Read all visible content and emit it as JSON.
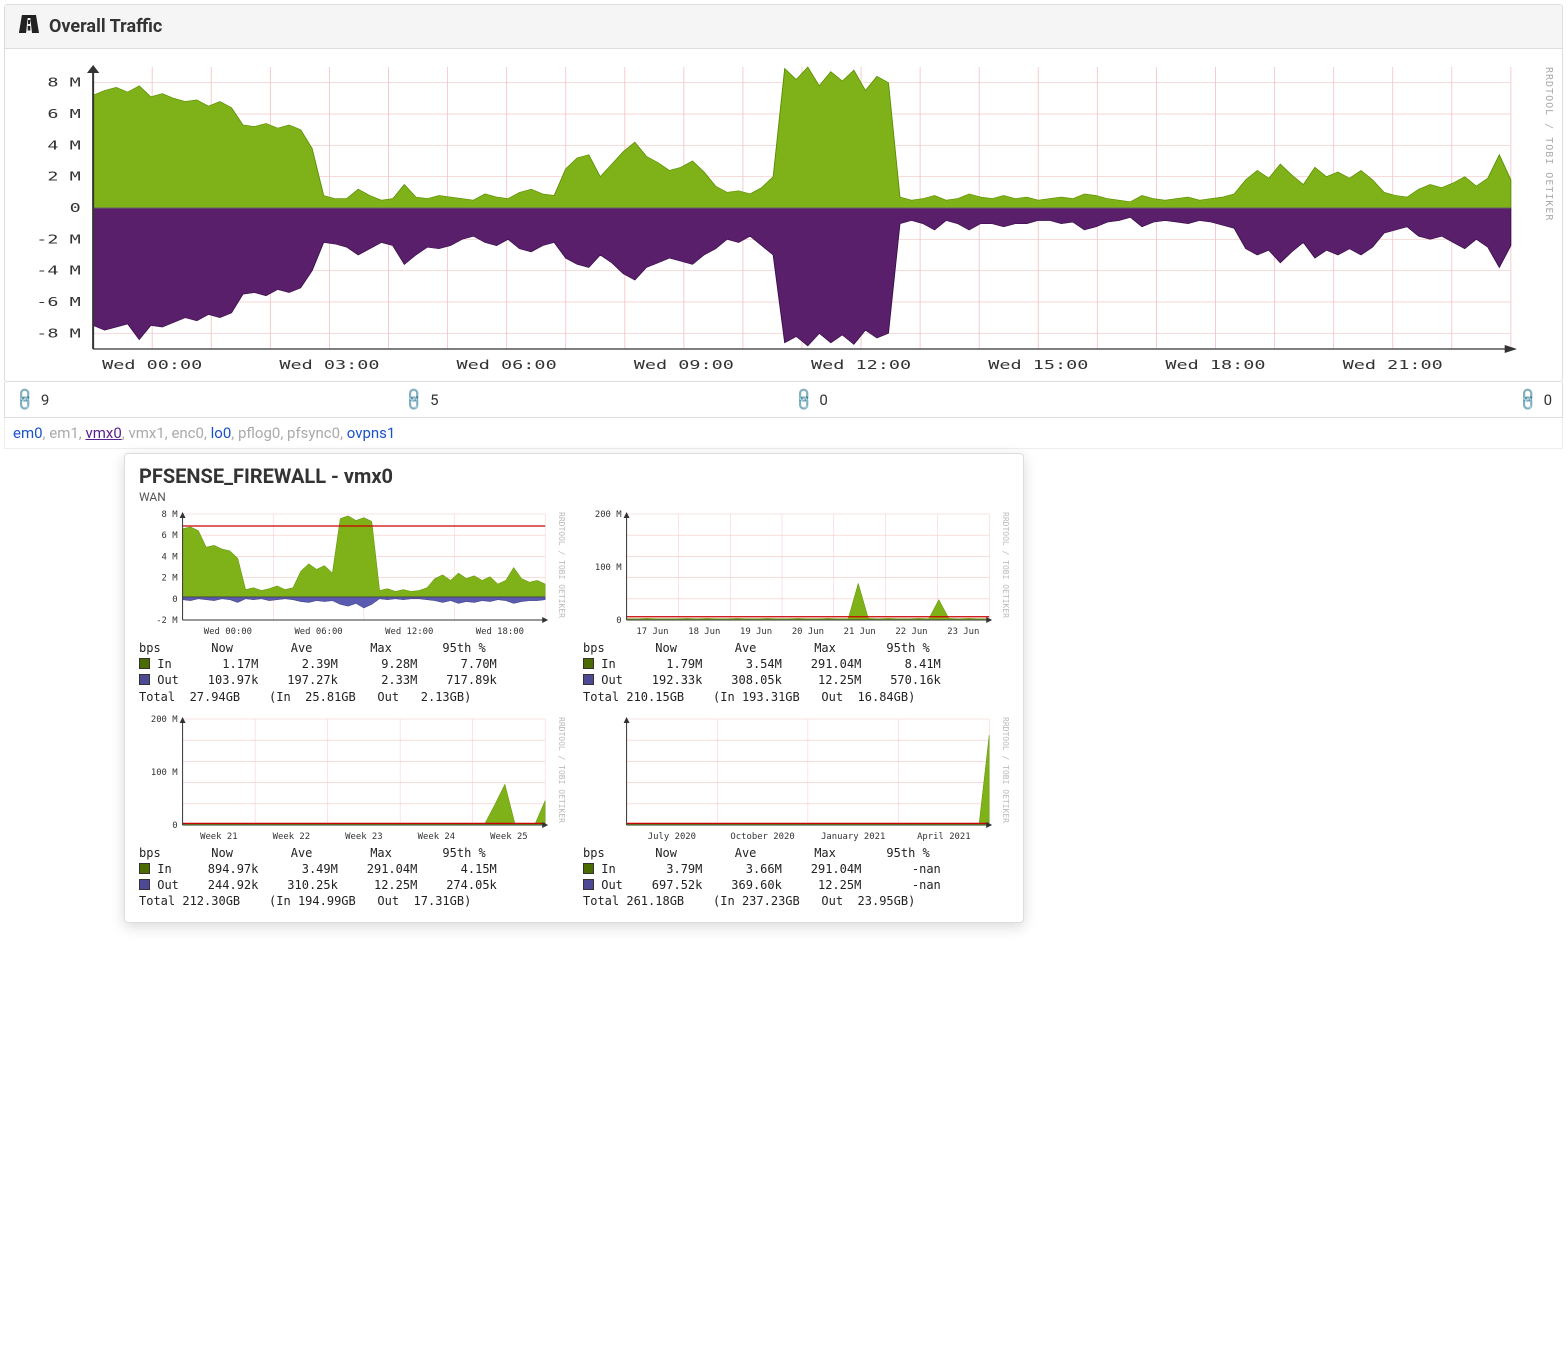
{
  "header": {
    "title": "Overall Traffic"
  },
  "side_label": "RRDTOOL / TOBI OETIKER",
  "big_chart": {
    "ylim": [
      -9,
      9
    ],
    "y_ticks": [
      "8 M",
      "6 M",
      "4 M",
      "2 M",
      "0",
      "-2 M",
      "-4 M",
      "-6 M",
      "-8 M"
    ],
    "x_ticks": [
      "Wed 00:00",
      "Wed 03:00",
      "Wed 06:00",
      "Wed 09:00",
      "Wed 12:00",
      "Wed 15:00",
      "Wed 18:00",
      "Wed 21:00"
    ],
    "series_in": [
      7.2,
      7.5,
      7.7,
      7.4,
      7.8,
      7.1,
      7.3,
      7.0,
      6.8,
      6.9,
      6.5,
      6.8,
      6.4,
      5.3,
      5.2,
      5.4,
      5.1,
      5.3,
      5.0,
      3.8,
      0.8,
      0.6,
      0.6,
      1.2,
      0.8,
      0.5,
      0.6,
      1.5,
      0.7,
      0.6,
      0.8,
      0.7,
      0.6,
      0.5,
      0.9,
      0.7,
      0.6,
      1.0,
      1.2,
      0.9,
      0.8,
      2.5,
      3.2,
      3.4,
      2.0,
      2.8,
      3.6,
      4.2,
      3.3,
      2.9,
      2.4,
      2.6,
      3.0,
      2.3,
      1.4,
      1.0,
      1.1,
      0.9,
      1.3,
      2.0,
      8.9,
      8.2,
      9.0,
      7.8,
      8.7,
      8.1,
      8.8,
      7.5,
      8.4,
      8.0,
      0.7,
      0.5,
      0.6,
      0.8,
      0.5,
      0.6,
      0.9,
      0.7,
      0.6,
      0.8,
      0.6,
      0.7,
      0.5,
      0.6,
      0.7,
      0.6,
      0.9,
      0.8,
      0.6,
      0.5,
      0.4,
      0.8,
      0.6,
      0.5,
      0.6,
      0.7,
      0.5,
      0.6,
      0.7,
      0.9,
      1.8,
      2.4,
      1.9,
      2.8,
      2.1,
      1.5,
      2.6,
      2.0,
      2.3,
      1.9,
      2.4,
      1.8,
      1.0,
      0.8,
      0.7,
      1.2,
      1.5,
      1.3,
      1.6,
      2.0,
      1.4,
      1.9,
      3.4,
      1.8
    ],
    "series_out": [
      -7.5,
      -7.8,
      -7.6,
      -7.4,
      -8.4,
      -7.5,
      -7.6,
      -7.3,
      -7.0,
      -7.2,
      -6.8,
      -7.0,
      -6.7,
      -5.5,
      -5.4,
      -5.6,
      -5.2,
      -5.4,
      -5.1,
      -4.0,
      -2.2,
      -2.3,
      -2.5,
      -3.0,
      -2.6,
      -2.2,
      -2.4,
      -3.6,
      -3.0,
      -2.5,
      -2.6,
      -2.4,
      -2.0,
      -1.8,
      -2.2,
      -2.4,
      -2.0,
      -2.6,
      -2.8,
      -2.4,
      -2.2,
      -3.2,
      -3.6,
      -3.8,
      -3.0,
      -3.5,
      -4.2,
      -4.6,
      -3.8,
      -3.5,
      -3.2,
      -3.4,
      -3.6,
      -3.0,
      -2.6,
      -2.0,
      -2.2,
      -1.8,
      -2.4,
      -3.0,
      -8.6,
      -8.2,
      -8.8,
      -8.0,
      -8.6,
      -8.1,
      -8.7,
      -7.8,
      -8.3,
      -8.0,
      -1.0,
      -0.8,
      -1.0,
      -1.4,
      -0.8,
      -1.0,
      -1.4,
      -1.0,
      -1.0,
      -1.2,
      -1.0,
      -1.0,
      -0.8,
      -0.8,
      -1.0,
      -0.9,
      -1.4,
      -1.2,
      -0.9,
      -0.8,
      -0.6,
      -1.2,
      -0.9,
      -0.8,
      -0.9,
      -1.0,
      -0.8,
      -0.9,
      -1.1,
      -1.3,
      -2.6,
      -3.0,
      -2.7,
      -3.5,
      -2.8,
      -2.2,
      -3.2,
      -2.7,
      -3.0,
      -2.6,
      -3.0,
      -2.5,
      -1.6,
      -1.4,
      -1.2,
      -1.8,
      -2.0,
      -1.8,
      -2.2,
      -2.6,
      -2.0,
      -2.5,
      -3.8,
      -2.4
    ]
  },
  "status": {
    "total": "9",
    "up": "5",
    "down": "0",
    "unknown": "0"
  },
  "interfaces": [
    {
      "name": "em0",
      "cls": "if-blue"
    },
    {
      "name": "em1",
      "cls": "if-gray"
    },
    {
      "name": "vmx0",
      "cls": "if-purple underline"
    },
    {
      "name": "vmx1",
      "cls": "if-gray"
    },
    {
      "name": "enc0",
      "cls": "if-gray"
    },
    {
      "name": "lo0",
      "cls": "if-blue"
    },
    {
      "name": "pflog0",
      "cls": "if-gray"
    },
    {
      "name": "pfsync0",
      "cls": "if-gray"
    },
    {
      "name": "ovpns1",
      "cls": "if-blue"
    }
  ],
  "popup": {
    "title": "PFSENSE_FIREWALL - vmx0",
    "subtitle": "WAN",
    "charts": [
      {
        "y_ticks": [
          "8 M",
          "6 M",
          "4 M",
          "2 M",
          "0",
          "-2 M"
        ],
        "ylim": [
          -2.5,
          9
        ],
        "x_ticks": [
          "Wed 00:00",
          "Wed 06:00",
          "Wed 12:00",
          "Wed 18:00"
        ],
        "redline": 7.7,
        "series_in": [
          7.4,
          7.6,
          7.2,
          5.4,
          5.6,
          5.2,
          5.0,
          4.2,
          0.8,
          1.0,
          0.7,
          0.9,
          1.2,
          0.8,
          1.0,
          2.8,
          3.6,
          3.0,
          3.4,
          2.6,
          8.5,
          8.8,
          8.3,
          8.6,
          8.2,
          0.7,
          0.9,
          0.6,
          0.8,
          0.6,
          0.7,
          1.0,
          2.0,
          2.4,
          1.8,
          2.6,
          2.0,
          2.3,
          1.8,
          2.2,
          1.4,
          1.8,
          3.2,
          2.0,
          1.6,
          1.8,
          1.4
        ],
        "series_out": [
          -0.3,
          -0.4,
          -0.2,
          -0.3,
          -0.4,
          -0.2,
          -0.3,
          -0.6,
          -0.2,
          -0.3,
          -0.2,
          -0.4,
          -0.3,
          -0.2,
          -0.3,
          -0.5,
          -0.6,
          -0.4,
          -0.5,
          -0.4,
          -0.8,
          -1.0,
          -0.7,
          -1.2,
          -0.8,
          -0.2,
          -0.3,
          -0.2,
          -0.3,
          -0.2,
          -0.2,
          -0.3,
          -0.4,
          -0.6,
          -0.4,
          -0.7,
          -0.5,
          -0.6,
          -0.4,
          -0.5,
          -0.3,
          -0.4,
          -0.7,
          -0.5,
          -0.4,
          -0.4,
          -0.3
        ],
        "stats": {
          "header": "bps       Now        Ave        Max       95th %",
          "in": "In       1.17M      2.39M      9.28M      7.70M",
          "out": "Out    103.97k    197.27k      2.33M    717.89k",
          "total": "Total  27.94GB    (In  25.81GB   Out   2.13GB)"
        }
      },
      {
        "y_ticks": [
          "200 M",
          "100 M",
          "0"
        ],
        "ylim": [
          0,
          260
        ],
        "x_ticks": [
          "17 Jun",
          "18 Jun",
          "19 Jun",
          "20 Jun",
          "21 Jun",
          "22 Jun",
          "23 Jun"
        ],
        "redline": 8,
        "series_in": [
          3,
          3,
          4,
          3,
          3,
          3,
          4,
          3,
          4,
          3,
          3,
          4,
          3,
          3,
          4,
          3,
          3,
          4,
          3,
          3,
          4,
          3,
          3,
          90,
          4,
          3,
          4,
          3,
          3,
          4,
          3,
          50,
          4,
          3,
          4,
          3,
          3
        ],
        "series_out": [
          0,
          0,
          0,
          0,
          0,
          0,
          0,
          0,
          0,
          0,
          0,
          0,
          0,
          0,
          0,
          0,
          0,
          0,
          0,
          0,
          0,
          0,
          0,
          0,
          0,
          0,
          0,
          0,
          0,
          0,
          0,
          0,
          0,
          0,
          0,
          0,
          0
        ],
        "stats": {
          "header": "bps       Now        Ave        Max       95th %",
          "in": "In       1.79M      3.54M    291.04M      8.41M",
          "out": "Out    192.33k    308.05k     12.25M    570.16k",
          "total": "Total 210.15GB    (In 193.31GB   Out  16.84GB)"
        }
      },
      {
        "y_ticks": [
          "200 M",
          "100 M",
          "0"
        ],
        "ylim": [
          0,
          260
        ],
        "x_ticks": [
          "Week 21",
          "Week 22",
          "Week 23",
          "Week 24",
          "Week 25"
        ],
        "redline": 4,
        "series_in": [
          3,
          3,
          4,
          3,
          3,
          3,
          4,
          3,
          4,
          3,
          3,
          4,
          3,
          3,
          4,
          3,
          3,
          4,
          3,
          3,
          4,
          3,
          3,
          4,
          4,
          3,
          4,
          3,
          3,
          4,
          3,
          50,
          100,
          3,
          4,
          3,
          60
        ],
        "series_out": [
          0,
          0,
          0,
          0,
          0,
          0,
          0,
          0,
          0,
          0,
          0,
          0,
          0,
          0,
          0,
          0,
          0,
          0,
          0,
          0,
          0,
          0,
          0,
          0,
          0,
          0,
          0,
          0,
          0,
          0,
          0,
          0,
          0,
          0,
          0,
          0,
          0
        ],
        "stats": {
          "header": "bps       Now        Ave        Max       95th %",
          "in": "In     894.97k      3.49M    291.04M      4.15M",
          "out": "Out    244.92k    310.25k     12.25M    274.05k",
          "total": "Total 212.30GB    (In 194.99GB   Out  17.31GB)"
        }
      },
      {
        "y_ticks": [
          "",
          "",
          ""
        ],
        "ylim": [
          0,
          260
        ],
        "x_ticks": [
          "July 2020",
          "October 2020",
          "January 2021",
          "April 2021"
        ],
        "redline": 4,
        "series_in": [
          3,
          3,
          4,
          3,
          3,
          3,
          4,
          3,
          4,
          3,
          3,
          4,
          3,
          3,
          4,
          3,
          3,
          4,
          3,
          3,
          4,
          3,
          3,
          4,
          4,
          3,
          4,
          3,
          3,
          4,
          3,
          3,
          4,
          3,
          4,
          3,
          220
        ],
        "series_out": [
          0,
          0,
          0,
          0,
          0,
          0,
          0,
          0,
          0,
          0,
          0,
          0,
          0,
          0,
          0,
          0,
          0,
          0,
          0,
          0,
          0,
          0,
          0,
          0,
          0,
          0,
          0,
          0,
          0,
          0,
          0,
          0,
          0,
          0,
          0,
          0,
          0
        ],
        "stats": {
          "header": "bps       Now        Ave        Max       95th %",
          "in": "In       3.79M      3.66M    291.04M       -nan",
          "out": "Out    697.52k    369.60k     12.25M       -nan",
          "total": "Total 261.18GB    (In 237.23GB   Out  23.95GB)"
        }
      }
    ]
  },
  "chart_data": {
    "type": "area",
    "title": "Overall Traffic",
    "xlabel": "",
    "ylabel": "bps",
    "ylim": [
      -9000000,
      9000000
    ],
    "x_ticks": [
      "Wed 00:00",
      "Wed 03:00",
      "Wed 06:00",
      "Wed 09:00",
      "Wed 12:00",
      "Wed 15:00",
      "Wed 18:00",
      "Wed 21:00"
    ],
    "series": [
      {
        "name": "In (positive)",
        "color": "#7fb219",
        "values": [
          7.2,
          7.5,
          7.7,
          7.4,
          7.8,
          7.1,
          7.3,
          7.0,
          6.8,
          6.9,
          6.5,
          6.8,
          6.4,
          5.3,
          5.2,
          5.4,
          5.1,
          5.3,
          5.0,
          3.8,
          0.8,
          0.6,
          0.6,
          1.2,
          0.8,
          0.5,
          0.6,
          1.5,
          0.7,
          0.6,
          0.8,
          0.7,
          0.6,
          0.5,
          0.9,
          0.7,
          0.6,
          1.0,
          1.2,
          0.9,
          0.8,
          2.5,
          3.2,
          3.4,
          2.0,
          2.8,
          3.6,
          4.2,
          3.3,
          2.9,
          2.4,
          2.6,
          3.0,
          2.3,
          1.4,
          1.0,
          1.1,
          0.9,
          1.3,
          2.0,
          8.9,
          8.2,
          9.0,
          7.8,
          8.7,
          8.1,
          8.8,
          7.5,
          8.4,
          8.0,
          0.7,
          0.5,
          0.6,
          0.8,
          0.5,
          0.6,
          0.9,
          0.7,
          0.6,
          0.8,
          0.6,
          0.7,
          0.5,
          0.6,
          0.7,
          0.6,
          0.9,
          0.8,
          0.6,
          0.5,
          0.4,
          0.8,
          0.6,
          0.5,
          0.6,
          0.7,
          0.5,
          0.6,
          0.7,
          0.9,
          1.8,
          2.4,
          1.9,
          2.8,
          2.1,
          1.5,
          2.6,
          2.0,
          2.3,
          1.9,
          2.4,
          1.8,
          1.0,
          0.8,
          0.7,
          1.2,
          1.5,
          1.3,
          1.6,
          2.0,
          1.4,
          1.9,
          3.4,
          1.8
        ]
      },
      {
        "name": "Out (negative)",
        "color": "#5a1f6b",
        "values": [
          -7.5,
          -7.8,
          -7.6,
          -7.4,
          -8.4,
          -7.5,
          -7.6,
          -7.3,
          -7.0,
          -7.2,
          -6.8,
          -7.0,
          -6.7,
          -5.5,
          -5.4,
          -5.6,
          -5.2,
          -5.4,
          -5.1,
          -4.0,
          -2.2,
          -2.3,
          -2.5,
          -3.0,
          -2.6,
          -2.2,
          -2.4,
          -3.6,
          -3.0,
          -2.5,
          -2.6,
          -2.4,
          -2.0,
          -1.8,
          -2.2,
          -2.4,
          -2.0,
          -2.6,
          -2.8,
          -2.4,
          -2.2,
          -3.2,
          -3.6,
          -3.8,
          -3.0,
          -3.5,
          -4.2,
          -4.6,
          -3.8,
          -3.5,
          -3.2,
          -3.4,
          -3.6,
          -3.0,
          -2.6,
          -2.0,
          -2.2,
          -1.8,
          -2.4,
          -3.0,
          -8.6,
          -8.2,
          -8.8,
          -8.0,
          -8.6,
          -8.1,
          -8.7,
          -7.8,
          -8.3,
          -8.0,
          -1.0,
          -0.8,
          -1.0,
          -1.4,
          -0.8,
          -1.0,
          -1.4,
          -1.0,
          -1.0,
          -1.2,
          -1.0,
          -1.0,
          -0.8,
          -0.8,
          -1.0,
          -0.9,
          -1.4,
          -1.2,
          -0.9,
          -0.8,
          -0.6,
          -1.2,
          -0.9,
          -0.8,
          -0.9,
          -1.0,
          -0.8,
          -0.9,
          -1.1,
          -1.3,
          -2.6,
          -3.0,
          -2.7,
          -3.5,
          -2.8,
          -2.2,
          -3.2,
          -2.7,
          -3.0,
          -2.6,
          -3.0,
          -2.5,
          -1.6,
          -1.4,
          -1.2,
          -1.8,
          -2.0,
          -1.8,
          -2.2,
          -2.6,
          -2.0,
          -2.5,
          -3.8,
          -2.4
        ]
      }
    ]
  }
}
